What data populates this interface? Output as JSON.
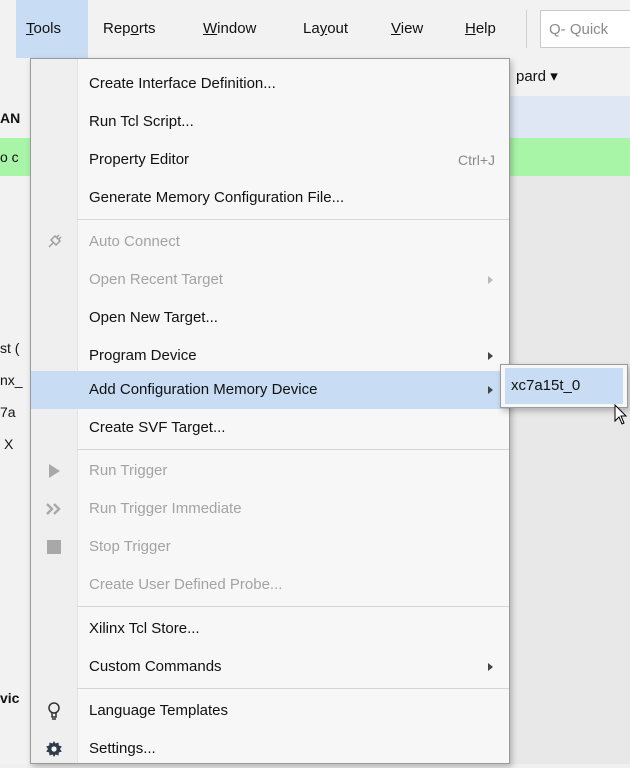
{
  "menubar": {
    "items": [
      {
        "label": "Tools",
        "mnemonic": "T"
      },
      {
        "label": "Reports",
        "mnemonic": "o"
      },
      {
        "label": "Window",
        "mnemonic": "W"
      },
      {
        "label": "Layout",
        "mnemonic": "y"
      },
      {
        "label": "View",
        "mnemonic": "V"
      },
      {
        "label": "Help",
        "mnemonic": "H"
      }
    ],
    "quick_access_placeholder": "Q- Quick"
  },
  "background": {
    "board_label": "pard ▾",
    "left_fragments": [
      "AN",
      "o c",
      "st (",
      "nx_",
      "7a",
      "X",
      "vic"
    ]
  },
  "tools_menu": {
    "items": [
      {
        "label": "Create Interface Definition...",
        "enabled": true
      },
      {
        "label": "Run Tcl Script...",
        "enabled": true,
        "mnemonic": "R"
      },
      {
        "label": "Property Editor",
        "enabled": true,
        "accelerator": "Ctrl+J"
      },
      {
        "label": "Generate Memory Configuration File...",
        "enabled": true
      },
      {
        "label": "Auto Connect",
        "enabled": false,
        "icon": "plug-icon"
      },
      {
        "label": "Open Recent Target",
        "enabled": false,
        "submenu": true
      },
      {
        "label": "Open New Target...",
        "enabled": true
      },
      {
        "label": "Program Device",
        "enabled": true,
        "submenu": true
      },
      {
        "label": "Add Configuration Memory Device",
        "enabled": true,
        "submenu": true,
        "highlighted": true
      },
      {
        "label": "Create SVF Target...",
        "enabled": true
      },
      {
        "label": "Run Trigger",
        "enabled": false,
        "icon": "play-icon"
      },
      {
        "label": "Run Trigger Immediate",
        "enabled": false,
        "icon": "fast-forward-icon"
      },
      {
        "label": "Stop Trigger",
        "enabled": false,
        "icon": "stop-icon"
      },
      {
        "label": "Create User Defined Probe...",
        "enabled": false
      },
      {
        "label": "Xilinx Tcl Store...",
        "enabled": true
      },
      {
        "label": "Custom Commands",
        "enabled": true,
        "submenu": true
      },
      {
        "label": "Language Templates",
        "enabled": true,
        "icon": "lightbulb-icon"
      },
      {
        "label": "Settings...",
        "enabled": true,
        "icon": "gear-icon"
      }
    ]
  },
  "submenu": {
    "items": [
      {
        "label": "xc7a15t_0",
        "highlighted": true
      }
    ]
  },
  "colors": {
    "highlight": "#c8dcf3",
    "disabled_text": "#a3a3a3",
    "green_bar": "#a8f5a8"
  }
}
